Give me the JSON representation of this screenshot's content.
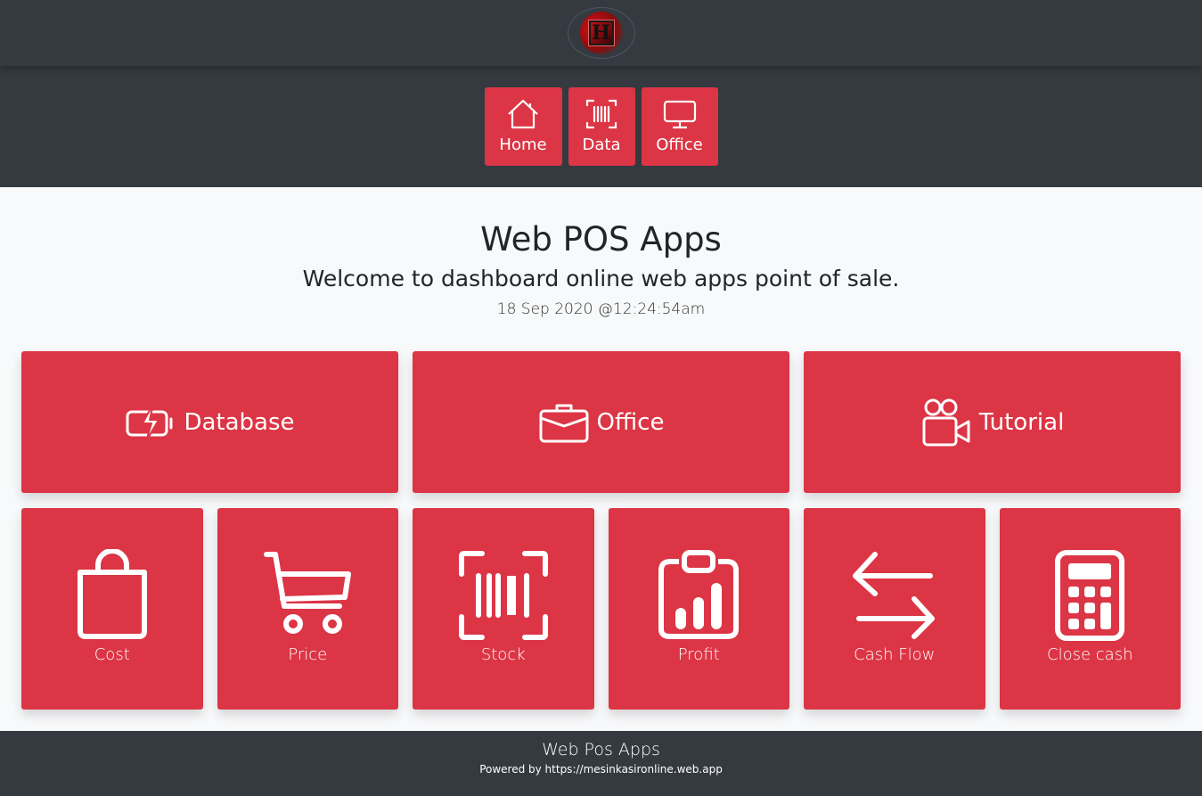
{
  "logo": {
    "letter": "H"
  },
  "nav": [
    {
      "label": "Home",
      "icon": "house-icon"
    },
    {
      "label": "Data",
      "icon": "barcode-scan-icon"
    },
    {
      "label": "Office",
      "icon": "monitor-icon"
    }
  ],
  "hero": {
    "title": "Web POS Apps",
    "subtitle": "Welcome to dashboard online web apps point of sale.",
    "datetime": "18 Sep 2020 @12:24:54am"
  },
  "top_cards": [
    {
      "label": "Database",
      "icon": "battery-charging-icon"
    },
    {
      "label": "Office",
      "icon": "briefcase-icon"
    },
    {
      "label": "Tutorial",
      "icon": "video-camera-icon"
    }
  ],
  "bottom_cards": [
    {
      "label": "Cost",
      "icon": "shopping-bag-icon"
    },
    {
      "label": "Price",
      "icon": "cart-icon"
    },
    {
      "label": "Stock",
      "icon": "barcode-scan-icon"
    },
    {
      "label": "Profit",
      "icon": "clipboard-chart-icon"
    },
    {
      "label": "Cash Flow",
      "icon": "arrows-exchange-icon"
    },
    {
      "label": "Close cash",
      "icon": "calculator-icon"
    }
  ],
  "footer": {
    "title": "Web Pos Apps",
    "powered": "Powered by https://mesinkasironline.web.app"
  },
  "colors": {
    "accent": "#dc3545",
    "dark": "#343a40",
    "background": "#f8f9fa"
  }
}
